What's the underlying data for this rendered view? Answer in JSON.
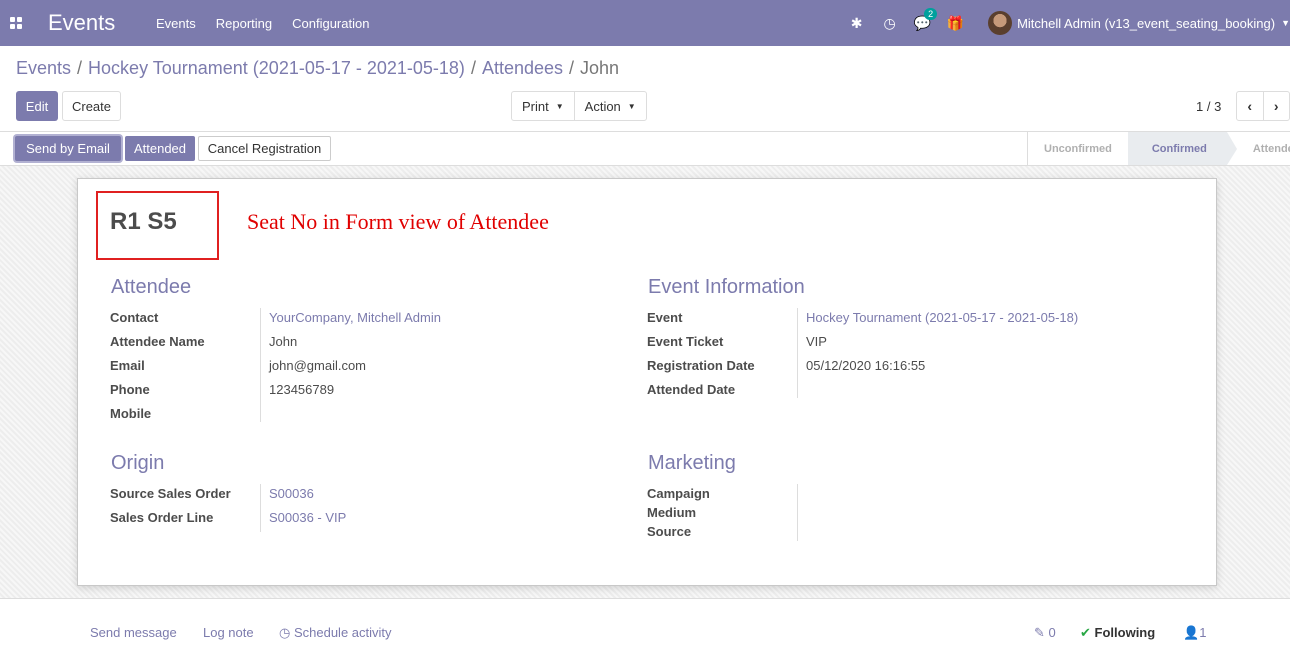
{
  "navbar": {
    "app_title": "Events",
    "menu": [
      "Events",
      "Reporting",
      "Configuration"
    ],
    "messages_badge": "2",
    "user_name": "Mitchell Admin (v13_event_seating_booking)"
  },
  "breadcrumb": {
    "items": [
      "Events",
      "Hockey Tournament (2021-05-17 - 2021-05-18)",
      "Attendees"
    ],
    "current": "John",
    "separator": "/"
  },
  "toolbar": {
    "edit_label": "Edit",
    "create_label": "Create",
    "print_label": "Print",
    "action_label": "Action",
    "pager": "1 / 3"
  },
  "statusbar": {
    "buttons": [
      "Send by Email",
      "Attended",
      "Cancel Registration"
    ],
    "stages": [
      "Unconfirmed",
      "Confirmed",
      "Attended"
    ],
    "active_stage": "Confirmed"
  },
  "record": {
    "seat_no": "R1 S5",
    "annotation": "Seat No in Form view of Attendee"
  },
  "attendee": {
    "title": "Attendee",
    "contact_label": "Contact",
    "contact_value": "YourCompany, Mitchell Admin",
    "name_label": "Attendee Name",
    "name_value": "John",
    "email_label": "Email",
    "email_value": "john@gmail.com",
    "phone_label": "Phone",
    "phone_value": "123456789",
    "mobile_label": "Mobile",
    "mobile_value": ""
  },
  "event_info": {
    "title": "Event Information",
    "event_label": "Event",
    "event_value": "Hockey Tournament (2021-05-17 - 2021-05-18)",
    "ticket_label": "Event Ticket",
    "ticket_value": "VIP",
    "reg_date_label": "Registration Date",
    "reg_date_value": "05/12/2020 16:16:55",
    "att_date_label": "Attended Date",
    "att_date_value": ""
  },
  "origin": {
    "title": "Origin",
    "sale_order_label": "Source Sales Order",
    "sale_order_value": "S00036",
    "order_line_label": "Sales Order Line",
    "order_line_value": "S00036 - VIP"
  },
  "marketing": {
    "title": "Marketing",
    "campaign_label": "Campaign",
    "medium_label": "Medium",
    "source_label": "Source"
  },
  "chatter": {
    "send_message": "Send message",
    "log_note": "Log note",
    "schedule_activity": "Schedule activity",
    "attachments_count": "0",
    "following": "Following",
    "followers_count": "1"
  },
  "colors": {
    "brand": "#7c7bad",
    "annotation_red": "#e00000",
    "badge_teal": "#00a09d"
  }
}
